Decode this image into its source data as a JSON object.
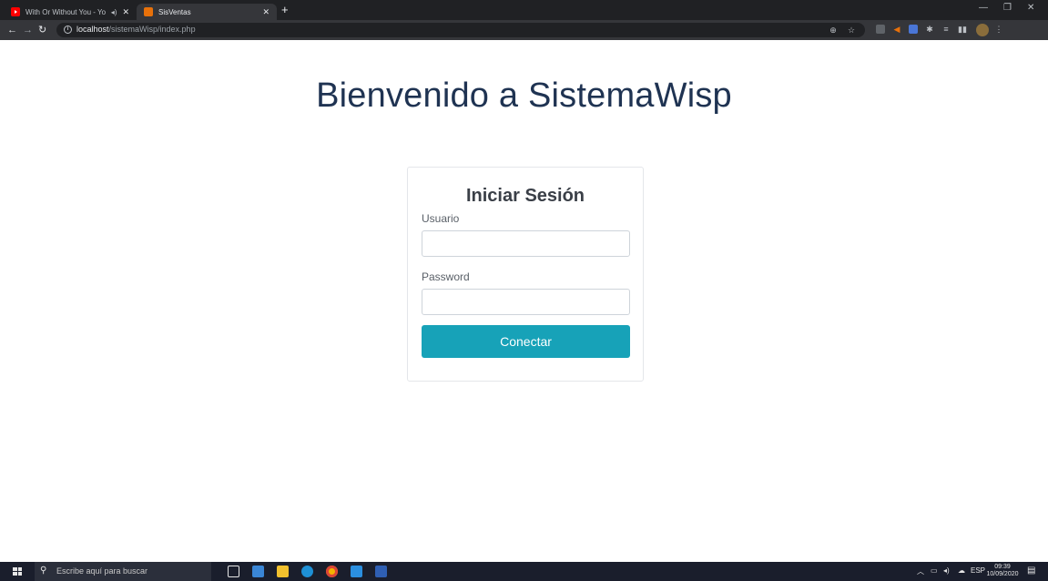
{
  "browser": {
    "tabs": [
      {
        "title": "With Or Without You - YouTube",
        "icon": "youtube-icon",
        "active": false
      },
      {
        "title": "SisVentas",
        "icon": "sisventas-favicon",
        "active": true
      }
    ],
    "url_host": "localhost",
    "url_path": "/sistemaWisp/index.php"
  },
  "page": {
    "welcome_title": "Bienvenido a SistemaWisp",
    "login": {
      "title": "Iniciar Sesión",
      "user_label": "Usuario",
      "user_value": "",
      "password_label": "Password",
      "password_value": "",
      "submit_label": "Conectar"
    }
  },
  "taskbar": {
    "search_placeholder": "Escribe aquí para buscar",
    "language": "ESP",
    "time": "09:39",
    "date": "10/09/2020"
  },
  "colors": {
    "title": "#1f3352",
    "button": "#17a2b8",
    "chrome_dark": "#202124",
    "chrome_toolbar": "#35363a",
    "taskbar": "#1a1e2c"
  }
}
